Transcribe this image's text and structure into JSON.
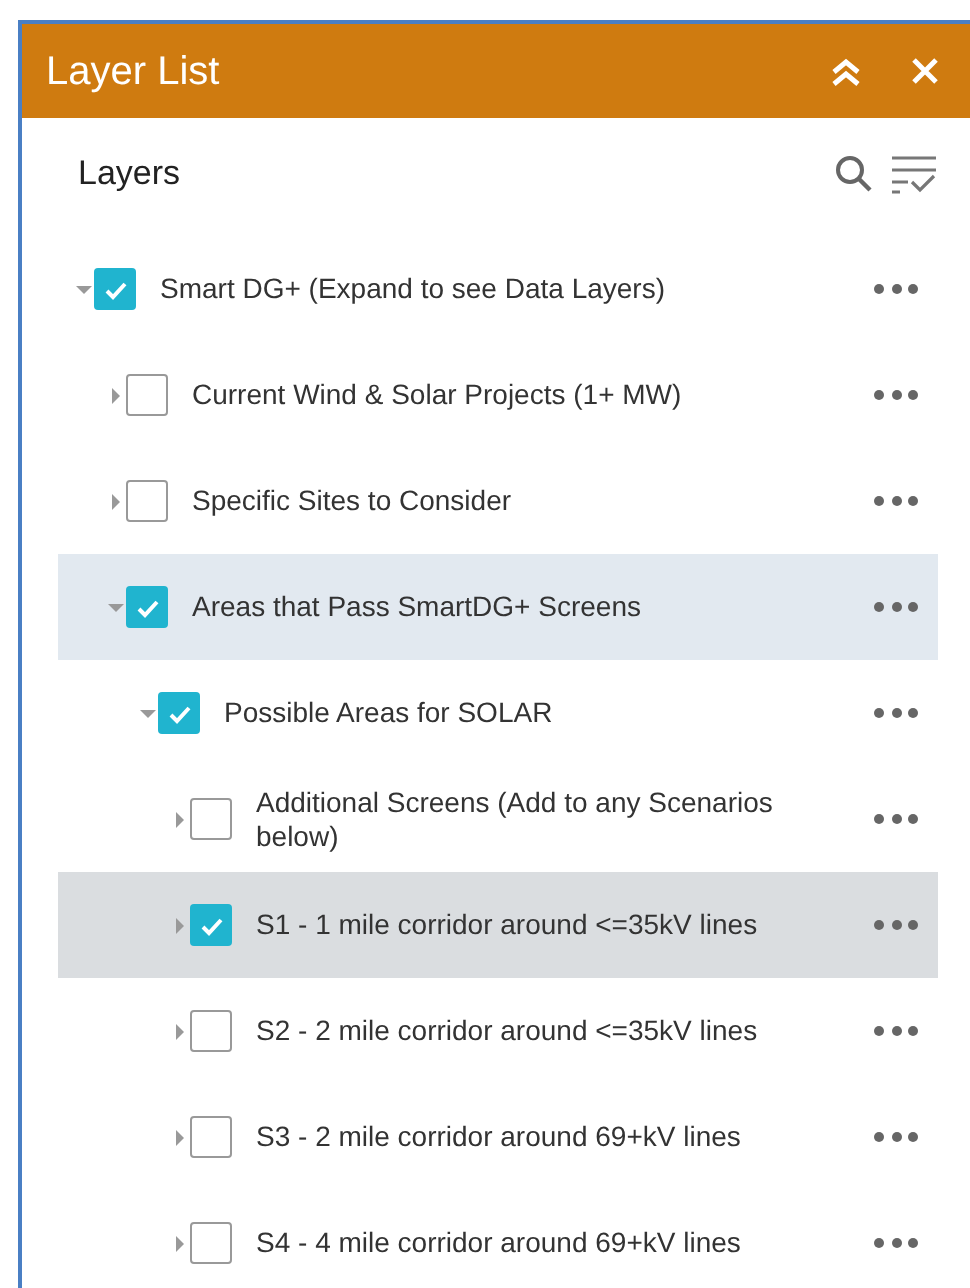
{
  "window": {
    "title": "Layer List"
  },
  "panel": {
    "heading": "Layers"
  },
  "layers": [
    {
      "label": "Smart DG+ (Expand to see Data Layers)",
      "checked": true,
      "expanded": true,
      "selected": false,
      "hovered": false,
      "children": [
        {
          "label": "Current Wind & Solar Projects (1+ MW)",
          "checked": false,
          "expanded": false,
          "selected": false,
          "hovered": false
        },
        {
          "label": "Specific Sites to Consider",
          "checked": false,
          "expanded": false,
          "selected": false,
          "hovered": false
        },
        {
          "label": "Areas that Pass SmartDG+ Screens",
          "checked": true,
          "expanded": true,
          "selected": true,
          "hovered": false,
          "children": [
            {
              "label": "Possible Areas for SOLAR",
              "checked": true,
              "expanded": true,
              "selected": false,
              "hovered": false,
              "children": [
                {
                  "label": "Additional Screens (Add to any Scenarios below)",
                  "checked": false,
                  "expanded": false,
                  "selected": false,
                  "hovered": false
                },
                {
                  "label": "S1 - 1 mile corridor around <=35kV lines",
                  "checked": true,
                  "expanded": false,
                  "selected": false,
                  "hovered": true
                },
                {
                  "label": "S2 - 2 mile corridor around <=35kV lines",
                  "checked": false,
                  "expanded": false,
                  "selected": false,
                  "hovered": false
                },
                {
                  "label": "S3 - 2 mile corridor around 69+kV lines",
                  "checked": false,
                  "expanded": false,
                  "selected": false,
                  "hovered": false
                },
                {
                  "label": "S4 - 4 mile corridor around 69+kV lines",
                  "checked": false,
                  "expanded": false,
                  "selected": false,
                  "hovered": false
                }
              ]
            }
          ]
        }
      ]
    }
  ]
}
